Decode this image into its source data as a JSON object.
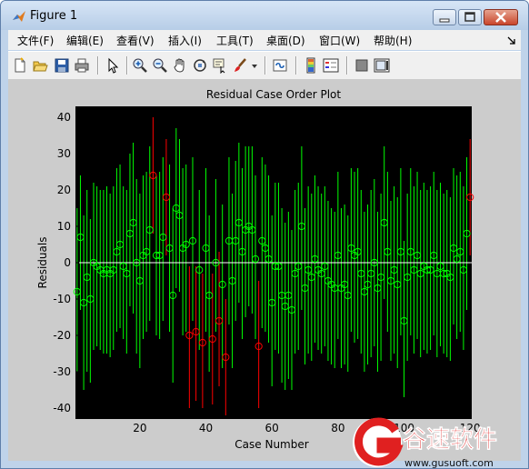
{
  "window": {
    "title": "Figure 1",
    "controls": {
      "minimize": "minimize-icon",
      "maximize": "maximize-icon",
      "close": "close-icon"
    }
  },
  "menu": {
    "items": [
      "文件(F)",
      "编辑(E)",
      "查看(V)",
      "插入(I)",
      "工具(T)",
      "桌面(D)",
      "窗口(W)",
      "帮助(H)"
    ]
  },
  "toolbar": {
    "icons": [
      "new-file-icon",
      "open-folder-icon",
      "save-icon",
      "print-icon",
      "pointer-icon",
      "zoom-in-icon",
      "zoom-out-icon",
      "pan-hand-icon",
      "rotate-3d-icon",
      "data-cursor-icon",
      "brush-icon",
      "link-plot-icon",
      "colorbar-icon",
      "legend-icon",
      "hide-plot-tools-icon",
      "show-plot-tools-icon"
    ]
  },
  "colors": {
    "axes_background": "#000000",
    "inlier": "#00ff00",
    "outlier": "#ff0000",
    "zero_line": "#ffffff",
    "figure_background": "#cccccc"
  },
  "chart_data": {
    "type": "scatter",
    "title": "Residual Case Order Plot",
    "xlabel": "Case Number",
    "ylabel": "Residuals",
    "xlim": [
      0.5,
      120.5
    ],
    "ylim": [
      -43,
      43
    ],
    "xticks": [
      20,
      40,
      60,
      80,
      100,
      120
    ],
    "yticks": [
      -40,
      -30,
      -20,
      -10,
      0,
      10,
      20,
      30,
      40
    ],
    "legend": "none",
    "grid": false,
    "series": [
      {
        "residuals": [
          -8,
          7,
          -11,
          -4,
          -10,
          0,
          -1,
          -2,
          -3,
          -2,
          -3,
          -2,
          3,
          5,
          -1,
          -3,
          8,
          11,
          0,
          -5,
          2,
          3,
          9,
          24,
          2,
          2,
          7,
          18,
          4,
          -9,
          15,
          13,
          4,
          5,
          -20,
          6,
          -19,
          -2,
          -22,
          4,
          -9,
          -21,
          0,
          -16,
          -6,
          -26,
          6,
          -5,
          6,
          11,
          3,
          9,
          10,
          9,
          1,
          -23,
          6,
          4,
          1,
          -11,
          -1,
          -1,
          -9,
          -12,
          -9,
          -13,
          -3,
          -1,
          10,
          -7,
          -2,
          -4,
          1,
          -2,
          -3,
          -1,
          -5,
          -6,
          -7,
          2,
          -7,
          -6,
          -9,
          4,
          2,
          3,
          -3,
          -8,
          -6,
          -3,
          0,
          -7,
          -4,
          11,
          3,
          -5,
          -2,
          -6,
          3,
          -16,
          -4,
          3,
          -2,
          2,
          -3,
          -1,
          -2,
          -2,
          2,
          -3,
          -1,
          -3,
          -3,
          -4,
          4,
          1,
          3,
          -2,
          8,
          18
        ],
        "interval_low": [
          -30,
          -13,
          -35,
          -30,
          -33,
          -24,
          -23,
          -24,
          -25,
          -25,
          -26,
          -24,
          -19,
          -18,
          -21,
          -25,
          -12,
          -14,
          -25,
          -29,
          -21,
          -19,
          -16,
          8,
          -20,
          -21,
          -16,
          2,
          -19,
          -33,
          -7,
          -8,
          -20,
          -19,
          -40,
          -16,
          -38,
          -24,
          -40,
          -19,
          -30,
          -39,
          -19,
          -34,
          -29,
          -42,
          -17,
          -29,
          -16,
          -11,
          -21,
          -15,
          -12,
          -14,
          -21,
          -40,
          -18,
          -19,
          -22,
          -34,
          -24,
          -25,
          -33,
          -35,
          -32,
          -35,
          -25,
          -24,
          -13,
          -28,
          -25,
          -27,
          -22,
          -24,
          -25,
          -23,
          -27,
          -28,
          -29,
          -21,
          -29,
          -28,
          -30,
          -19,
          -22,
          -21,
          -25,
          -30,
          -28,
          -26,
          -23,
          -30,
          -27,
          -10,
          -19,
          -27,
          -25,
          -29,
          -20,
          -37,
          -27,
          -20,
          -25,
          -21,
          -26,
          -24,
          -25,
          -24,
          -20,
          -26,
          -23,
          -25,
          -26,
          -27,
          -17,
          -21,
          -19,
          -24,
          -13,
          2
        ],
        "interval_high": [
          15,
          24,
          13,
          20,
          12,
          22,
          21,
          20,
          20,
          21,
          19,
          21,
          26,
          27,
          21,
          20,
          30,
          33,
          23,
          19,
          24,
          25,
          32,
          40,
          24,
          25,
          29,
          34,
          27,
          15,
          37,
          34,
          26,
          27,
          -1,
          29,
          -1,
          20,
          -3,
          26,
          13,
          -3,
          23,
          3,
          16,
          -10,
          29,
          19,
          28,
          33,
          26,
          32,
          32,
          32,
          24,
          -5,
          29,
          27,
          24,
          13,
          22,
          22,
          15,
          11,
          14,
          9,
          20,
          22,
          32,
          15,
          21,
          19,
          24,
          21,
          19,
          21,
          17,
          15,
          14,
          25,
          15,
          16,
          13,
          26,
          25,
          26,
          20,
          14,
          16,
          20,
          23,
          14,
          19,
          32,
          25,
          17,
          21,
          18,
          26,
          6,
          19,
          26,
          21,
          25,
          20,
          22,
          20,
          21,
          25,
          20,
          22,
          19,
          20,
          18,
          26,
          24,
          25,
          21,
          29,
          34
        ],
        "outlier_case_numbers": [
          24,
          28,
          35,
          37,
          39,
          42,
          44,
          46,
          56,
          120
        ]
      }
    ]
  },
  "watermark": {
    "brand": "谷速软件",
    "url": "www.gusuoft.com"
  }
}
